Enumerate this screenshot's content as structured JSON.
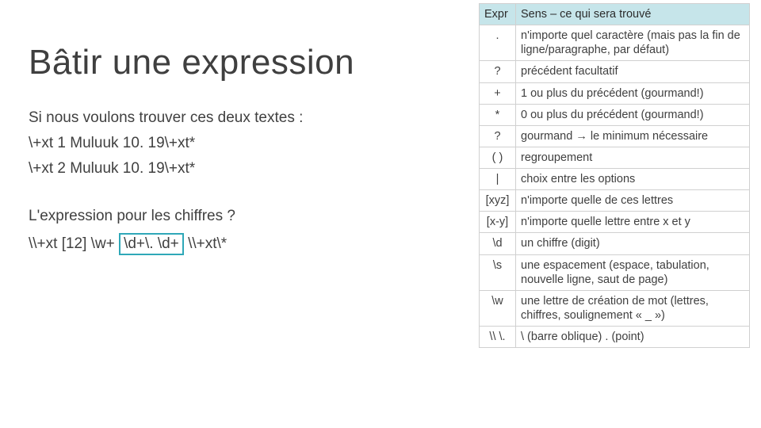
{
  "title": "Bâtir une expression",
  "intro": "Si nous voulons trouver ces deux textes :",
  "sample1": "\\+xt 1 Muluuk 10. 19\\+xt*",
  "sample2": "\\+xt 2 Muluuk 10. 19\\+xt*",
  "question": "L'expression pour les chiffres ?",
  "regex_pre": "\\\\+xt [12] \\w+ ",
  "regex_boxed": "\\d+\\. \\d+",
  "regex_post": " \\\\+xt\\*",
  "table": {
    "headers": {
      "expr": "Expr",
      "sens": "Sens – ce qui sera trouvé"
    },
    "rows": [
      {
        "expr": ".",
        "sens": "n'importe quel caractère (mais pas la fin de ligne/paragraphe, par défaut)"
      },
      {
        "expr": "?",
        "sens": "précédent facultatif"
      },
      {
        "expr": "+",
        "sens": "1 ou plus du précédent (gourmand!)"
      },
      {
        "expr": "*",
        "sens": "0 ou plus du précédent (gourmand!)"
      },
      {
        "expr": "?",
        "sens": "gourmand → le minimum nécessaire"
      },
      {
        "expr": "( )",
        "sens": "regroupement"
      },
      {
        "expr": "|",
        "sens": "choix entre les options"
      },
      {
        "expr": "[xyz]",
        "sens": "n'importe quelle de ces lettres"
      },
      {
        "expr": "[x-y]",
        "sens": "n'importe quelle lettre entre x et y"
      },
      {
        "expr": "\\d",
        "sens": "un chiffre (digit)"
      },
      {
        "expr": "\\s",
        "sens": "une espacement (espace, tabulation, nouvelle ligne, saut de page)"
      },
      {
        "expr": "\\w",
        "sens": "une lettre de création de mot (lettres, chiffres, soulignement « _ »)"
      },
      {
        "expr": "\\\\ \\.",
        "sens": "\\ (barre oblique) . (point)"
      }
    ]
  }
}
